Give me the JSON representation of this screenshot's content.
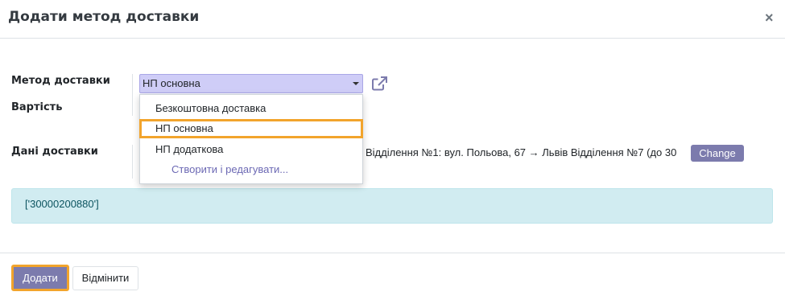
{
  "dialog": {
    "title": "Додати метод доставки",
    "close_label": "×"
  },
  "form": {
    "method_label": "Метод доставки",
    "cost_label": "Вартість",
    "delivery_data_label": "Дані доставки",
    "method_value": "НП основна",
    "delivery_text": "Відділення №1: вул. Польова, 67 → Львів Відділення №7 (до 30",
    "change_label": "Change"
  },
  "dropdown": {
    "items": [
      {
        "label": "Безкоштовна доставка"
      },
      {
        "label": "НП основна"
      },
      {
        "label": "НП додаткова"
      }
    ],
    "create_label": "Створити і редагувати..."
  },
  "info": {
    "text": "['30000200880']"
  },
  "footer": {
    "add_label": "Додати",
    "cancel_label": "Відмінити"
  },
  "colors": {
    "accent": "#7c7bad",
    "highlight": "#f2a42c",
    "select_bg": "#cfcdf7",
    "info_bg": "#d1ecf1"
  },
  "icons": {
    "close": "close-icon",
    "external": "external-link-icon",
    "caret": "caret-down-icon"
  }
}
